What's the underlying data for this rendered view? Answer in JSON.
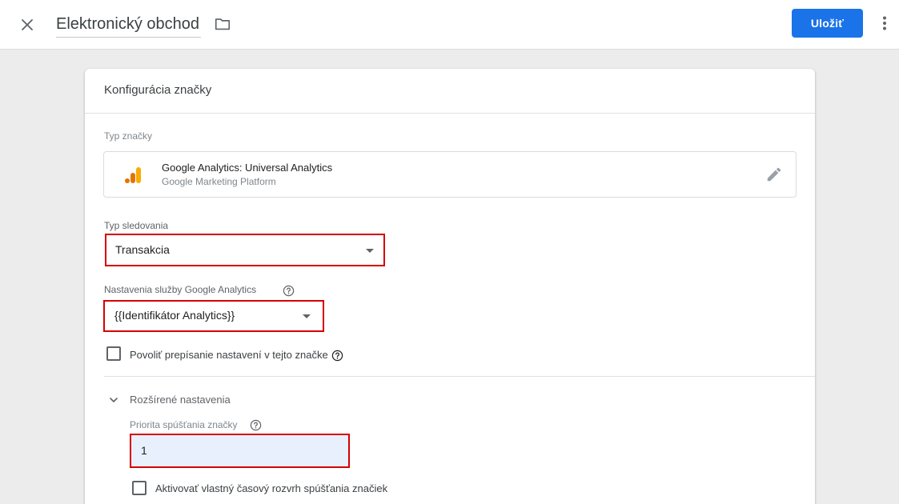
{
  "topbar": {
    "title": "Elektronický obchod",
    "save_label": "Uložiť",
    "icons": {
      "close": "close-icon",
      "folder": "folder-icon",
      "more": "more-vert-icon"
    }
  },
  "card": {
    "title": "Konfigurácia značky",
    "tag_type": {
      "label": "Typ značky",
      "name": "Google Analytics: Universal Analytics",
      "provider": "Google Marketing Platform",
      "logo_colors": [
        "#f9ab00",
        "#e37400"
      ]
    },
    "track_type": {
      "label": "Typ sledovania",
      "value": "Transakcia"
    },
    "ga_settings": {
      "label": "Nastavenia služby Google Analytics",
      "value": "{{Identifikátor Analytics}}"
    },
    "override": {
      "label": "Povoliť prepísanie nastavení v tejto značke",
      "checked": false
    },
    "advanced": {
      "label": "Rozšírené nastavenia",
      "expanded": true,
      "priority": {
        "label": "Priorita spúšťania značky",
        "value": "1"
      },
      "schedule": {
        "label": "Aktivovať vlastný časový rozvrh spúšťania značiek",
        "checked": false
      }
    }
  },
  "colors": {
    "accent": "#1a73e8",
    "highlight_border": "#d50000",
    "input_fill": "#e8f0fe"
  }
}
